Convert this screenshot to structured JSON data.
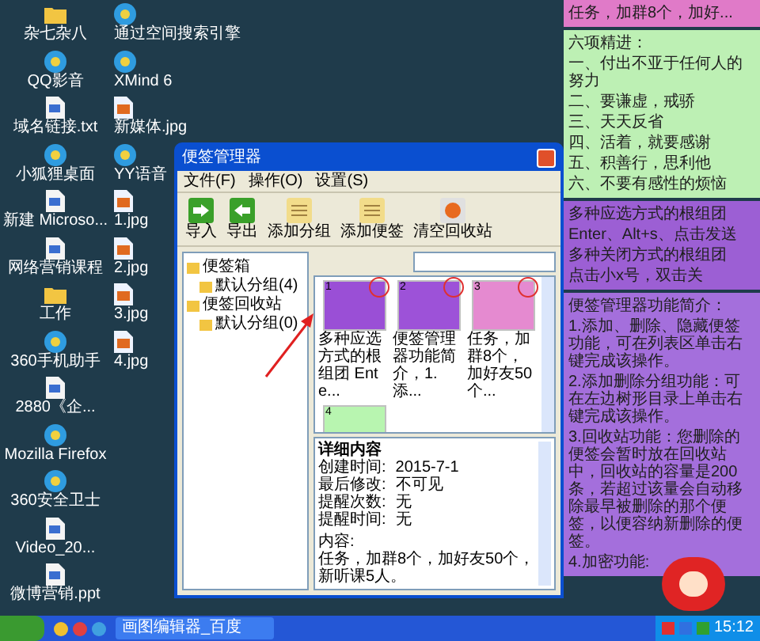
{
  "desktop_columns": [
    [
      {
        "label": "杂七杂八",
        "kind": "folder"
      },
      {
        "label": "QQ影音",
        "kind": "app"
      },
      {
        "label": "域名链接.txt",
        "kind": "file"
      },
      {
        "label": "小狐狸桌面",
        "kind": "app"
      },
      {
        "label": "新建 Microso...",
        "kind": "file"
      },
      {
        "label": "网络营销课程",
        "kind": "file"
      },
      {
        "label": "工作",
        "kind": "folder"
      },
      {
        "label": "360手机助手",
        "kind": "app"
      },
      {
        "label": "2880《企...",
        "kind": "file"
      },
      {
        "label": "Mozilla Firefox",
        "kind": "app"
      },
      {
        "label": "360安全卫士",
        "kind": "app"
      },
      {
        "label": "Video_20...",
        "kind": "file"
      },
      {
        "label": "微博营销.ppt",
        "kind": "file"
      }
    ],
    [
      {
        "label": "通过空间搜索引擎",
        "kind": "app"
      },
      {
        "label": "XMind 6",
        "kind": "app"
      },
      {
        "label": "新媒体.jpg",
        "kind": "image"
      },
      {
        "label": "YY语音",
        "kind": "app"
      },
      {
        "label": "1.jpg",
        "kind": "image"
      },
      {
        "label": "2.jpg",
        "kind": "image"
      },
      {
        "label": "3.jpg",
        "kind": "image"
      },
      {
        "label": "4.jpg",
        "kind": "image"
      }
    ]
  ],
  "dialog": {
    "title": "便签管理器",
    "menu": [
      "文件(F)",
      "操作(O)",
      "设置(S)"
    ],
    "toolbar": [
      {
        "label": "导入",
        "kind": "import"
      },
      {
        "label": "导出",
        "kind": "export"
      },
      {
        "label": "添加分组",
        "kind": "group"
      },
      {
        "label": "添加便签",
        "kind": "note"
      },
      {
        "label": "清空回收站",
        "kind": "trash"
      }
    ],
    "tree": [
      {
        "label": "便签箱",
        "children": [
          {
            "label": "默认分组(4)"
          }
        ]
      },
      {
        "label": "便签回收站",
        "children": [
          {
            "label": "默认分组(0)"
          }
        ]
      }
    ],
    "notes": [
      {
        "number": "1",
        "caption": "多种应选方式的根组团 Ente...",
        "color": "#9a4fd6",
        "circled": true
      },
      {
        "number": "2",
        "caption": "便签管理器功能简介，1.添...",
        "color": "#9d52d8",
        "circled": true
      },
      {
        "number": "3",
        "caption": "任务，加群8个，加好友50个...",
        "color": "#e58ad0",
        "circled": true
      },
      {
        "number": "4",
        "color": "#b8f5b0",
        "circled": false
      }
    ],
    "details": {
      "heading": "详细内容",
      "fields": [
        {
          "label": "创建时间:",
          "value": "2015-7-1"
        },
        {
          "label": "最后修改:",
          "value": "不可见"
        },
        {
          "label": "提醒次数:",
          "value": "无"
        },
        {
          "label": "提醒时间:",
          "value": "无"
        }
      ],
      "content_label": "内容:",
      "content": "任务，加群8个，加好友50个，新听课5人。"
    }
  },
  "sticky_notes": [
    {
      "color": "#e07ac8",
      "lines": [
        "任务，加群8个，加好..."
      ]
    },
    {
      "color": "#bdf0b4",
      "lines": [
        "六项精进：",
        "一、付出不亚于任何人的努力",
        "二、要谦虚，戒骄",
        "三、天天反省",
        "四、活着，就要感谢",
        "五、积善行，思利他",
        "六、不要有感性的烦恼"
      ]
    },
    {
      "color": "#9c5fd4",
      "lines": [
        "多种应选方式的根组团",
        "Enter、Alt+s、点击发送",
        "多种关闭方式的根组团",
        "点击小x号，双击关"
      ]
    },
    {
      "color": "#a46fdc",
      "lines": [
        "便签管理器功能简介：",
        "1.添加、删除、隐藏便签功能，可在列表区单击右键完成该操作。",
        "2.添加删除分组功能：可在左边树形目录上单击右键完成该操作。",
        "3.回收站功能：您删除的便签会暂时放在回收站中，回收站的容量是200条，若超过该量会自动移除最早被删除的那个便签，以便容纳新删除的便签。",
        "4.加密功能:"
      ]
    }
  ],
  "taskbar": {
    "task": "画图编辑器_百度",
    "clock": "15:12"
  }
}
